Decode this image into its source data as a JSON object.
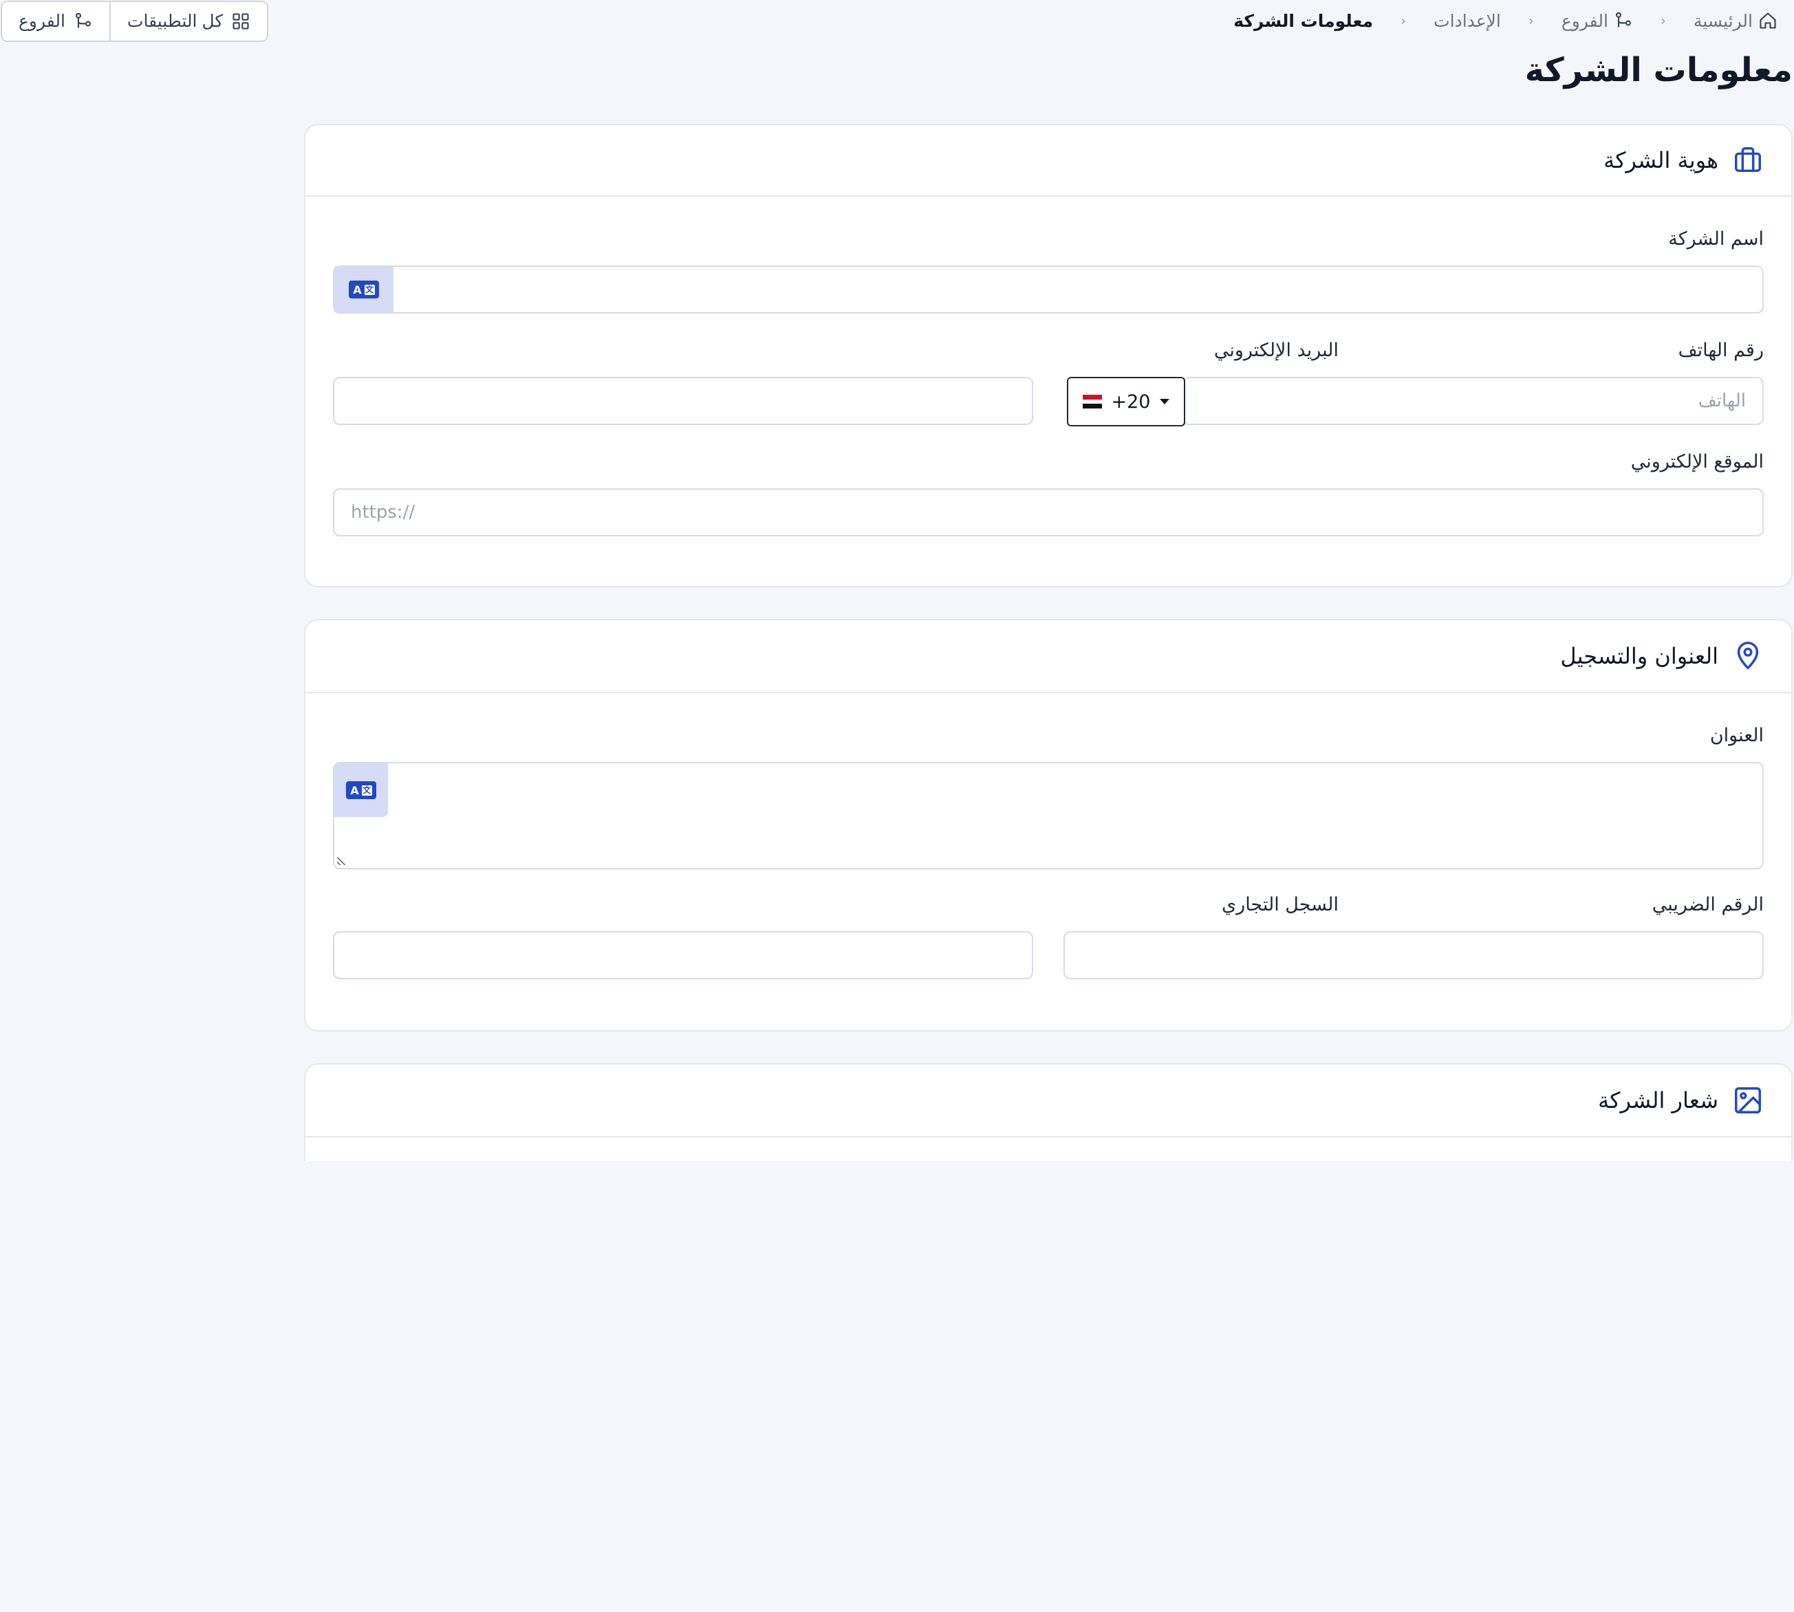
{
  "breadcrumb": {
    "home": "الرئيسية",
    "branches": "الفروع",
    "settings": "الإعدادات",
    "current": "معلومات الشركة",
    "separator": "‹"
  },
  "top_actions": {
    "all_apps": "كل التطبيقات",
    "branches": "الفروع"
  },
  "page_title": "معلومات الشركة",
  "identity": {
    "title": "هوية الشركة",
    "company_name_label": "اسم الشركة",
    "company_name_value": "",
    "phone_label": "رقم الهاتف",
    "phone_placeholder": "الهاتف",
    "country_code": "+20",
    "email_label": "البريد الإلكتروني",
    "email_value": "",
    "website_label": "الموقع الإلكتروني",
    "website_placeholder": "https://"
  },
  "address": {
    "title": "العنوان والتسجيل",
    "address_label": "العنوان",
    "address_value": "",
    "tax_label": "الرقم الضريبي",
    "tax_value": "",
    "cr_label": "السجل التجاري",
    "cr_value": ""
  },
  "logo": {
    "title": "شعار الشركة"
  },
  "colors": {
    "accent": "#2348c5",
    "translate_bg": "#d6dcf5"
  }
}
